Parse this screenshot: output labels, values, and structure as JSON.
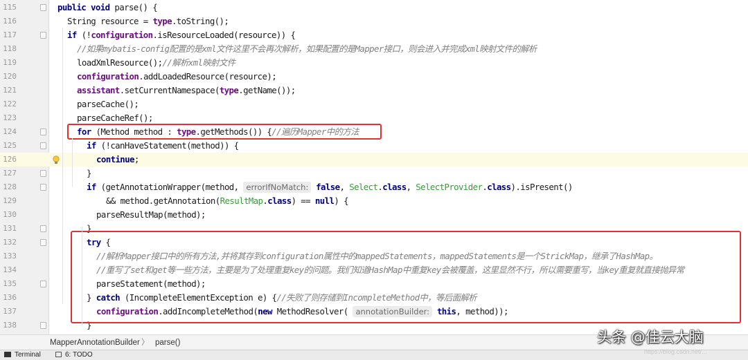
{
  "editor": {
    "highlighted_line": "126",
    "lines": [
      {
        "num": "115",
        "tokens": [
          {
            "t": "public",
            "c": "kw"
          },
          {
            "t": " "
          },
          {
            "t": "void",
            "c": "kw"
          },
          {
            "t": " parse() {"
          }
        ]
      },
      {
        "num": "116",
        "tokens": [
          {
            "t": "String resource = "
          },
          {
            "t": "type",
            "c": "fld"
          },
          {
            "t": ".toString();"
          }
        ]
      },
      {
        "num": "117",
        "tokens": [
          {
            "t": "if",
            "c": "kw"
          },
          {
            "t": " (!"
          },
          {
            "t": "configuration",
            "c": "fld"
          },
          {
            "t": ".isResourceLoaded(resource)) {"
          }
        ]
      },
      {
        "num": "118",
        "tokens": [
          {
            "t": "//如果mybatis-config配置的是xml文件这里不会再次解析，如果配置的是Mapper接口，则会进入并完成xml映射文件的解析",
            "c": "cm"
          }
        ]
      },
      {
        "num": "119",
        "tokens": [
          {
            "t": "loadXmlResource();"
          },
          {
            "t": "//解析xml映射文件",
            "c": "cm"
          }
        ]
      },
      {
        "num": "120",
        "tokens": [
          {
            "t": "configuration",
            "c": "fld"
          },
          {
            "t": ".addLoadedResource(resource);"
          }
        ]
      },
      {
        "num": "121",
        "tokens": [
          {
            "t": "assistant",
            "c": "fld"
          },
          {
            "t": ".setCurrentNamespace("
          },
          {
            "t": "type",
            "c": "fld"
          },
          {
            "t": ".getName());"
          }
        ]
      },
      {
        "num": "122",
        "tokens": [
          {
            "t": "parseCache();"
          }
        ]
      },
      {
        "num": "123",
        "tokens": [
          {
            "t": "parseCacheRef();"
          }
        ]
      },
      {
        "num": "124",
        "tokens": [
          {
            "t": "for",
            "c": "kw"
          },
          {
            "t": " (Method method : "
          },
          {
            "t": "type",
            "c": "fld"
          },
          {
            "t": ".getMethods()) {"
          },
          {
            "t": "//遍历Mapper中的方法",
            "c": "cm"
          }
        ]
      },
      {
        "num": "125",
        "tokens": [
          {
            "t": "if",
            "c": "kw"
          },
          {
            "t": " (!canHaveStatement(method)) {"
          }
        ]
      },
      {
        "num": "126",
        "tokens": [
          {
            "t": "continue",
            "c": "kw"
          },
          {
            "t": ";"
          }
        ]
      },
      {
        "num": "127",
        "tokens": [
          {
            "t": "}"
          }
        ]
      },
      {
        "num": "128",
        "tokens": [
          {
            "t": "if",
            "c": "kw"
          },
          {
            "t": " (getAnnotationWrapper(method, "
          },
          {
            "t": "errorIfNoMatch:",
            "c": "hint"
          },
          {
            "t": " "
          },
          {
            "t": "false",
            "c": "kw"
          },
          {
            "t": ", "
          },
          {
            "t": "Select",
            "c": "cls"
          },
          {
            "t": "."
          },
          {
            "t": "class",
            "c": "kw"
          },
          {
            "t": ", "
          },
          {
            "t": "SelectProvider",
            "c": "cls"
          },
          {
            "t": "."
          },
          {
            "t": "class",
            "c": "kw"
          },
          {
            "t": ").isPresent()"
          }
        ]
      },
      {
        "num": "129",
        "tokens": [
          {
            "t": "&& method.getAnnotation("
          },
          {
            "t": "ResultMap",
            "c": "cls"
          },
          {
            "t": "."
          },
          {
            "t": "class",
            "c": "kw"
          },
          {
            "t": ") == "
          },
          {
            "t": "null",
            "c": "kw"
          },
          {
            "t": ") {"
          }
        ]
      },
      {
        "num": "130",
        "tokens": [
          {
            "t": "parseResultMap(method);"
          }
        ]
      },
      {
        "num": "131",
        "tokens": [
          {
            "t": "}"
          }
        ]
      },
      {
        "num": "132",
        "tokens": [
          {
            "t": "try",
            "c": "kw"
          },
          {
            "t": " {"
          }
        ]
      },
      {
        "num": "133",
        "tokens": [
          {
            "t": "//解析Mapper接口中的所有方法,并将其存到configuration属性中的mappedStatements，mappedStatements是一个StrickMap，继承了HashMap。",
            "c": "cm"
          }
        ]
      },
      {
        "num": "134",
        "tokens": [
          {
            "t": "//重写了set和get等一些方法，主要是为了处理重复key的问题。我们知道HashMap中重复key会被覆盖，这里显然不行，所以需要重写，当key重复就直接抛异常",
            "c": "cm"
          }
        ]
      },
      {
        "num": "135",
        "tokens": [
          {
            "t": "parseStatement(method);"
          }
        ]
      },
      {
        "num": "136",
        "tokens": [
          {
            "t": "} "
          },
          {
            "t": "catch",
            "c": "kw"
          },
          {
            "t": " (IncompleteElementException e) {"
          },
          {
            "t": "//失败了则存储到IncompleteMethod中，等后面解析",
            "c": "cm"
          }
        ]
      },
      {
        "num": "137",
        "tokens": [
          {
            "t": "configuration",
            "c": "fld"
          },
          {
            "t": ".addIncompleteMethod("
          },
          {
            "t": "new",
            "c": "kw"
          },
          {
            "t": " MethodResolver( "
          },
          {
            "t": "annotationBuilder:",
            "c": "hint"
          },
          {
            "t": " "
          },
          {
            "t": "this",
            "c": "kw"
          },
          {
            "t": ", method));"
          }
        ]
      },
      {
        "num": "138",
        "tokens": [
          {
            "t": "}"
          }
        ]
      }
    ]
  },
  "breadcrumb": {
    "class_name": "MapperAnnotationBuilder",
    "separator": "〉",
    "method": "parse()"
  },
  "toolwindows": {
    "terminal": "Terminal",
    "todo": "6: TODO"
  },
  "watermark": {
    "main": "头条 @佳云大脑",
    "faint": "https://blog.csdn.net/..."
  },
  "colors": {
    "keyword": "#000080",
    "field": "#660e7a",
    "comment": "#808080",
    "class_ref": "#3a9a3a",
    "annotation_box": "#e03030",
    "current_line": "#fdfbe3"
  }
}
